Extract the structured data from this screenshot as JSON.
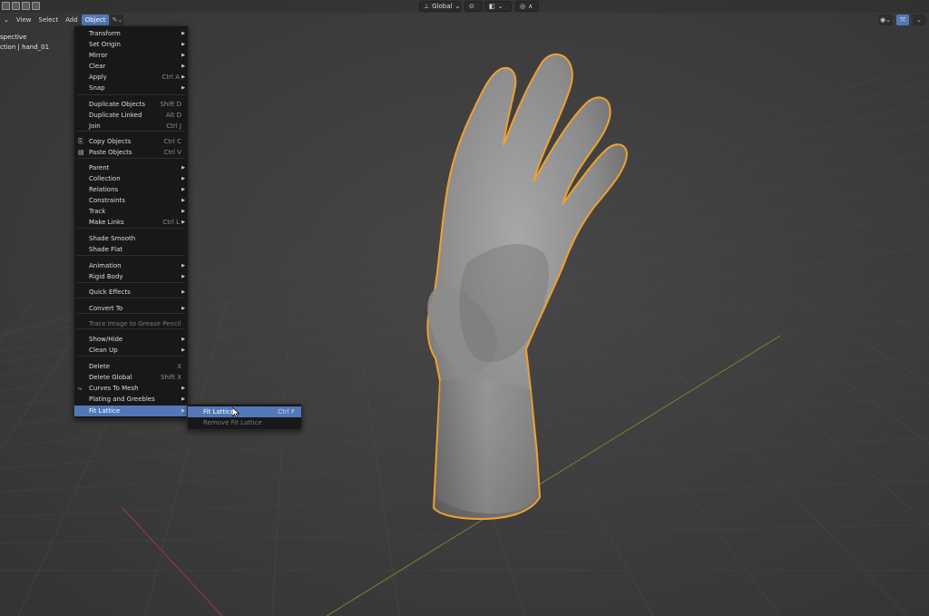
{
  "header": {
    "menus": [
      "View",
      "Select",
      "Add",
      "Object"
    ],
    "active_menu": "Object"
  },
  "topbar": {
    "orientation": "Global",
    "snap_icons": [
      "snap-icon",
      "proportional-edit-icon"
    ]
  },
  "viewport": {
    "view_name": "spective",
    "collection_label": "ction | hand_01"
  },
  "object_menu": {
    "items": [
      {
        "label": "Transform",
        "shortcut": "",
        "submenu": true
      },
      {
        "label": "Set Origin",
        "shortcut": "",
        "submenu": true
      },
      {
        "label": "Mirror",
        "shortcut": "",
        "submenu": true
      },
      {
        "label": "Clear",
        "shortcut": "",
        "submenu": true
      },
      {
        "label": "Apply",
        "shortcut": "Ctrl A",
        "submenu": true
      },
      {
        "label": "Snap",
        "shortcut": "",
        "submenu": true
      },
      {
        "label": "Duplicate Objects",
        "shortcut": "Shift D",
        "submenu": false
      },
      {
        "label": "Duplicate Linked",
        "shortcut": "Alt D",
        "submenu": false
      },
      {
        "label": "Join",
        "shortcut": "Ctrl J",
        "submenu": false
      },
      {
        "label": "Copy Objects",
        "shortcut": "Ctrl C",
        "submenu": false
      },
      {
        "label": "Paste Objects",
        "shortcut": "Ctrl V",
        "submenu": false
      },
      {
        "label": "Parent",
        "shortcut": "",
        "submenu": true
      },
      {
        "label": "Collection",
        "shortcut": "",
        "submenu": true
      },
      {
        "label": "Relations",
        "shortcut": "",
        "submenu": true
      },
      {
        "label": "Constraints",
        "shortcut": "",
        "submenu": true
      },
      {
        "label": "Track",
        "shortcut": "",
        "submenu": true
      },
      {
        "label": "Make Links",
        "shortcut": "Ctrl L",
        "submenu": true
      },
      {
        "label": "Shade Smooth",
        "shortcut": "",
        "submenu": false
      },
      {
        "label": "Shade Flat",
        "shortcut": "",
        "submenu": false
      },
      {
        "label": "Animation",
        "shortcut": "",
        "submenu": true
      },
      {
        "label": "Rigid Body",
        "shortcut": "",
        "submenu": true
      },
      {
        "label": "Quick Effects",
        "shortcut": "",
        "submenu": true
      },
      {
        "label": "Convert To",
        "shortcut": "",
        "submenu": true
      },
      {
        "label": "Trace Image to Grease Pencil",
        "shortcut": "",
        "submenu": false
      },
      {
        "label": "Show/Hide",
        "shortcut": "",
        "submenu": true
      },
      {
        "label": "Clean Up",
        "shortcut": "",
        "submenu": true
      },
      {
        "label": "Delete",
        "shortcut": "X",
        "submenu": false
      },
      {
        "label": "Delete Global",
        "shortcut": "Shift X",
        "submenu": false
      },
      {
        "label": "Curves To Mesh",
        "shortcut": "",
        "submenu": true
      },
      {
        "label": "Plating and Greebles",
        "shortcut": "",
        "submenu": true
      },
      {
        "label": "Fit Lattice",
        "shortcut": "",
        "submenu": true
      }
    ]
  },
  "fit_lattice_submenu": {
    "items": [
      {
        "label": "Fit Lattice",
        "shortcut": "Ctrl F"
      },
      {
        "label": "Remove Fit Lattice",
        "shortcut": ""
      }
    ]
  },
  "colors": {
    "highlight": "#5278b8",
    "selection_outline": "#f0a030",
    "x_axis": "#9a3a44",
    "y_axis": "#6e8a32"
  }
}
